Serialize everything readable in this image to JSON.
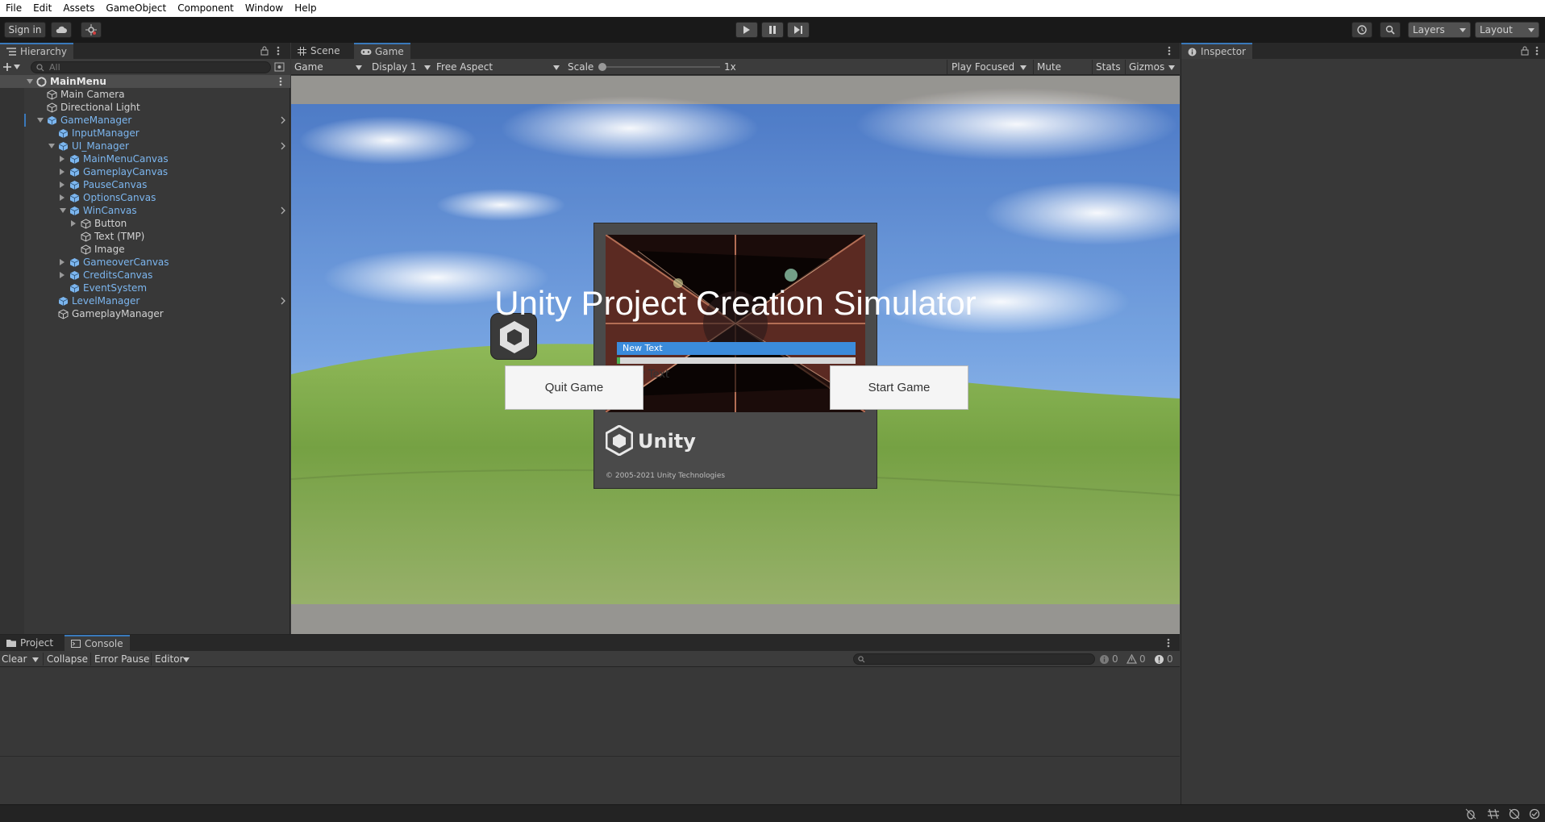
{
  "menu": [
    "File",
    "Edit",
    "Assets",
    "GameObject",
    "Component",
    "Window",
    "Help"
  ],
  "toolbar": {
    "sign_in": "Sign in",
    "layers": "Layers",
    "layout": "Layout"
  },
  "hierarchy": {
    "tab": "Hierarchy",
    "search_placeholder": "All",
    "scene": "MainMenu",
    "items": [
      {
        "label": "Main Camera",
        "depth": 1,
        "prefab": false,
        "arrow": "none"
      },
      {
        "label": "Directional Light",
        "depth": 1,
        "prefab": false,
        "arrow": "none"
      },
      {
        "label": "GameManager",
        "depth": 1,
        "prefab": true,
        "arrow": "down"
      },
      {
        "label": "InputManager",
        "depth": 2,
        "prefab": true,
        "arrow": "none"
      },
      {
        "label": "UI_Manager",
        "depth": 2,
        "prefab": true,
        "arrow": "down"
      },
      {
        "label": "MainMenuCanvas",
        "depth": 3,
        "prefab": true,
        "arrow": "right"
      },
      {
        "label": "GameplayCanvas",
        "depth": 3,
        "prefab": true,
        "arrow": "right"
      },
      {
        "label": "PauseCanvas",
        "depth": 3,
        "prefab": true,
        "arrow": "right"
      },
      {
        "label": "OptionsCanvas",
        "depth": 3,
        "prefab": true,
        "arrow": "right"
      },
      {
        "label": "WinCanvas",
        "depth": 3,
        "prefab": true,
        "arrow": "down"
      },
      {
        "label": "Button",
        "depth": 4,
        "prefab": false,
        "arrow": "right"
      },
      {
        "label": "Text (TMP)",
        "depth": 4,
        "prefab": false,
        "arrow": "none"
      },
      {
        "label": "Image",
        "depth": 4,
        "prefab": false,
        "arrow": "none"
      },
      {
        "label": "GameoverCanvas",
        "depth": 3,
        "prefab": true,
        "arrow": "right"
      },
      {
        "label": "CreditsCanvas",
        "depth": 3,
        "prefab": true,
        "arrow": "right"
      },
      {
        "label": "EventSystem",
        "depth": 3,
        "prefab": true,
        "arrow": "none"
      },
      {
        "label": "LevelManager",
        "depth": 2,
        "prefab": true,
        "arrow": "none"
      },
      {
        "label": "GameplayManager",
        "depth": 2,
        "prefab": false,
        "arrow": "none"
      }
    ]
  },
  "view_tabs": {
    "scene": "Scene",
    "game": "Game"
  },
  "game_toolbar": {
    "mode": "Game",
    "display": "Display 1",
    "aspect": "Free Aspect",
    "scale_label": "Scale",
    "scale_value": "1x",
    "play_focused": "Play Focused",
    "mute_audio": "Mute Audio",
    "stats": "Stats",
    "gizmos": "Gizmos"
  },
  "game_view": {
    "title": "Unity Project Creation Simulator",
    "quit_button": "Quit Game",
    "start_button": "Start Game",
    "splash_bar_text": "New Text",
    "splash_behind_text": "y Text",
    "unity_logo_text": "Unity",
    "copyright": "© 2005-2021 Unity Technologies"
  },
  "inspector": {
    "tab": "Inspector"
  },
  "bottom_tabs": {
    "project": "Project",
    "console": "Console"
  },
  "console_toolbar": {
    "clear": "Clear",
    "collapse": "Collapse",
    "error_pause": "Error Pause",
    "editor": "Editor",
    "log_count": "0",
    "warn_count": "0",
    "error_count": "0"
  },
  "colors": {
    "accent": "#3a79bb",
    "prefab_blue": "#7cb6ef",
    "panel": "#383838"
  }
}
